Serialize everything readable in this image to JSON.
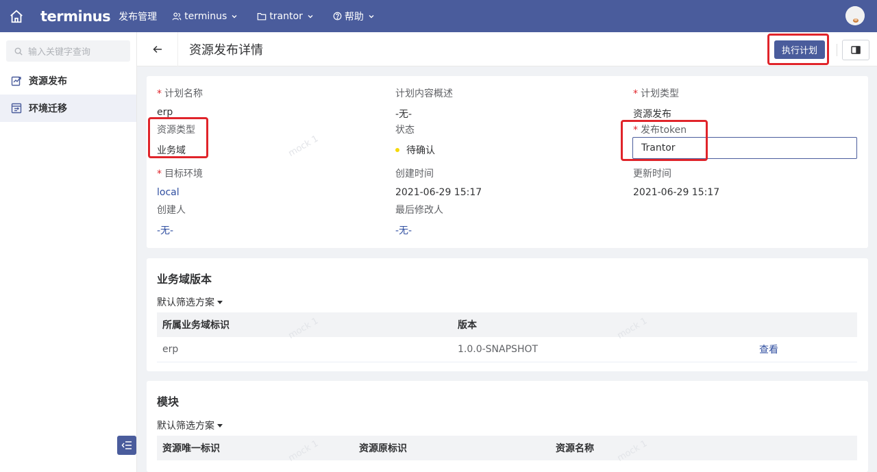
{
  "topbar": {
    "brand": "terminus",
    "app_name": "发布管理",
    "menus": [
      {
        "label": "terminus",
        "icon": "user-group-icon"
      },
      {
        "label": "trantor",
        "icon": "folder-icon"
      },
      {
        "label": "帮助",
        "icon": "help-circle-icon"
      }
    ]
  },
  "sidebar": {
    "search_placeholder": "输入关键字查询",
    "items": [
      {
        "label": "资源发布",
        "icon": "publish-icon",
        "active": false
      },
      {
        "label": "环境迁移",
        "icon": "migrate-icon",
        "active": true
      }
    ]
  },
  "header": {
    "title": "资源发布详情",
    "execute_label": "执行计划"
  },
  "details": {
    "plan_name_label": "计划名称",
    "plan_name_value": "erp",
    "summary_label": "计划内容概述",
    "summary_value": "-无-",
    "plan_type_label": "计划类型",
    "plan_type_value": "资源发布",
    "resource_type_label": "资源类型",
    "resource_type_value": "业务域",
    "status_label": "状态",
    "status_value": "待确认",
    "token_label": "发布token",
    "token_value": "Trantor",
    "target_env_label": "目标环境",
    "target_env_value": "local",
    "created_time_label": "创建时间",
    "created_time_value": "2021-06-29 15:17",
    "updated_time_label": "更新时间",
    "updated_time_value": "2021-06-29 15:17",
    "creator_label": "创建人",
    "creator_value": "-无-",
    "modifier_label": "最后修改人",
    "modifier_value": "-无-",
    "status_color": "#f5d90a"
  },
  "domain_versions": {
    "title": "业务域版本",
    "filter_label": "默认筛选方案",
    "columns": [
      "所属业务域标识",
      "版本"
    ],
    "rows": [
      {
        "domain": "erp",
        "version": "1.0.0-SNAPSHOT",
        "action": "查看"
      }
    ]
  },
  "modules": {
    "title": "模块",
    "filter_label": "默认筛选方案",
    "columns": [
      "资源唯一标识",
      "资源原标识",
      "资源名称"
    ]
  },
  "watermark_text": "mock 1",
  "colors": {
    "primary": "#4a5c9c",
    "highlight": "#e0242a",
    "link": "#2f4ea0"
  }
}
